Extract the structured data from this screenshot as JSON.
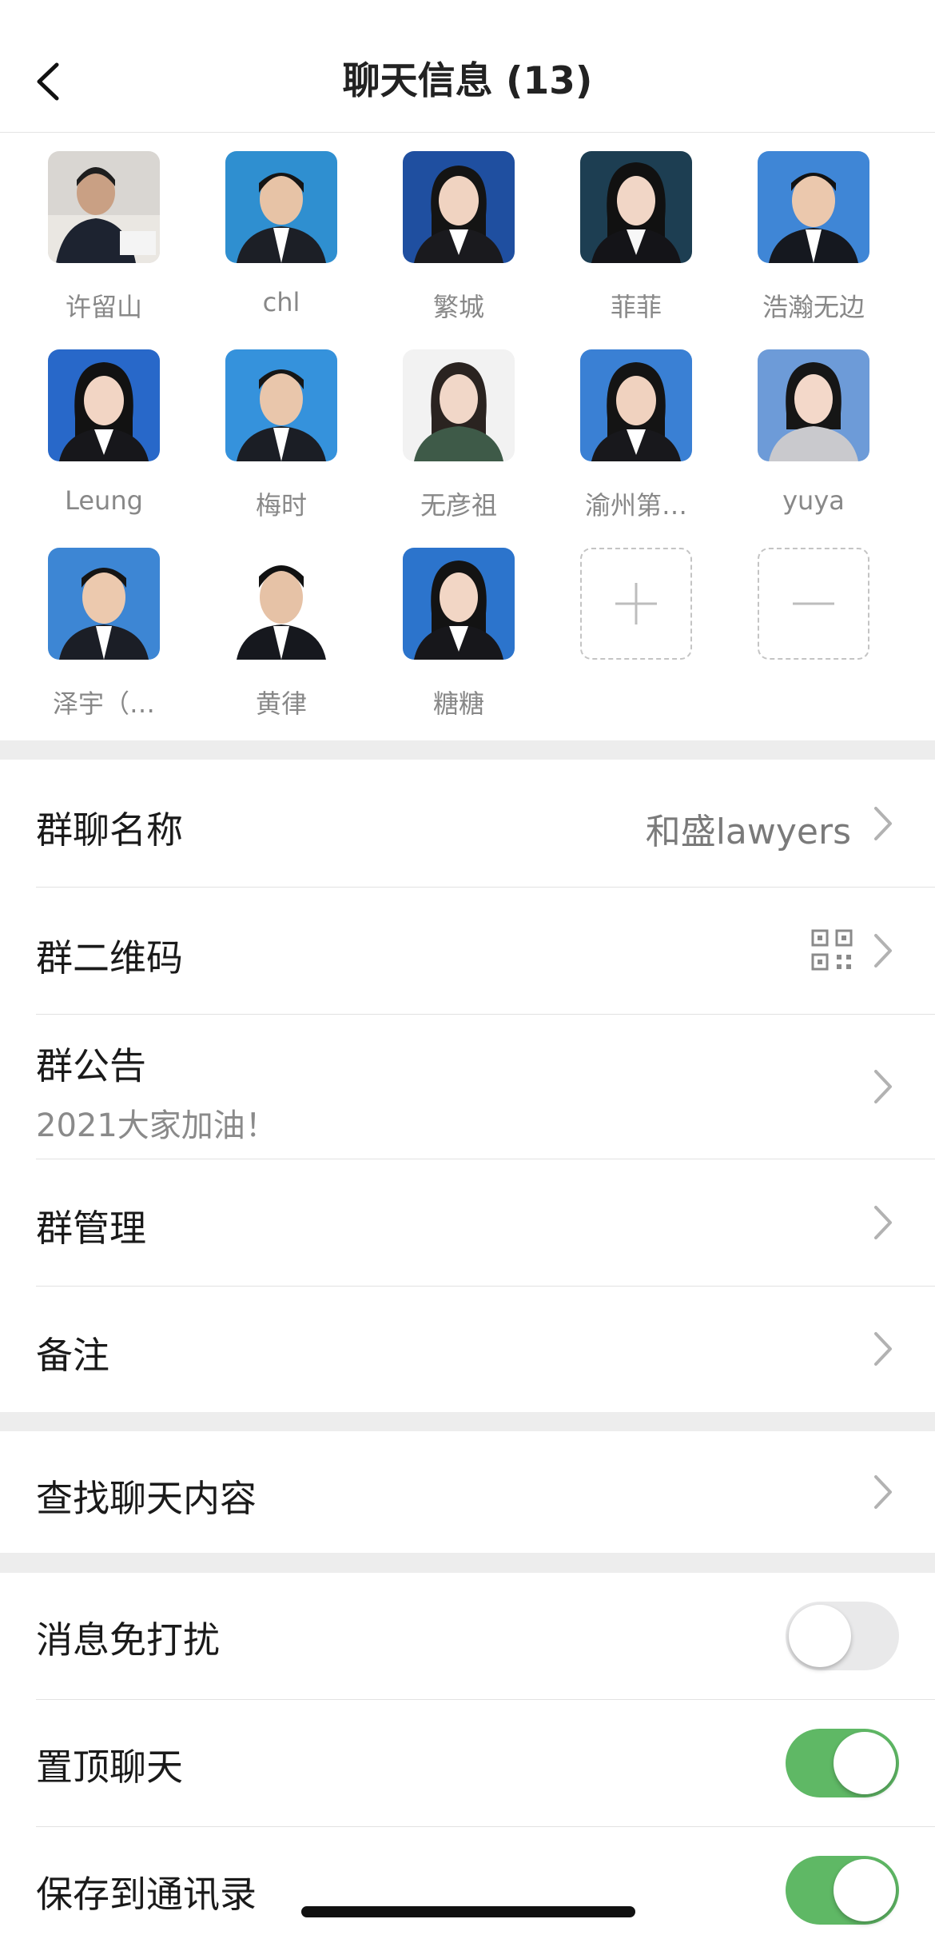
{
  "header": {
    "title": "聊天信息 (13)",
    "back_icon": "chevron-left-icon"
  },
  "members": [
    {
      "name": "许留山"
    },
    {
      "name": "chl"
    },
    {
      "name": "繁城"
    },
    {
      "name": "菲菲"
    },
    {
      "name": "浩瀚无边"
    },
    {
      "name": "Leung"
    },
    {
      "name": "梅时"
    },
    {
      "name": "无彦祖"
    },
    {
      "name": "渝州第…"
    },
    {
      "name": "yuya"
    },
    {
      "name": "泽宇（…"
    },
    {
      "name": "黄律"
    },
    {
      "name": "糖糖"
    }
  ],
  "member_actions": {
    "add_icon": "plus-icon",
    "remove_icon": "minus-icon"
  },
  "settings": {
    "group_name": {
      "label": "群聊名称",
      "value": "和盛lawyers"
    },
    "group_qr": {
      "label": "群二维码",
      "icon": "qr-code-icon"
    },
    "announcement": {
      "label": "群公告",
      "value": "2021大家加油！"
    },
    "management": {
      "label": "群管理"
    },
    "remark": {
      "label": "备注"
    },
    "search_history": {
      "label": "查找聊天内容"
    },
    "mute": {
      "label": "消息免打扰",
      "on": false
    },
    "pin": {
      "label": "置顶聊天",
      "on": true
    },
    "save_contacts": {
      "label": "保存到通讯录",
      "on": true
    }
  },
  "colors": {
    "toggle_on": "#5fb865",
    "toggle_off": "#e9e9ea",
    "background": "#ededed"
  }
}
